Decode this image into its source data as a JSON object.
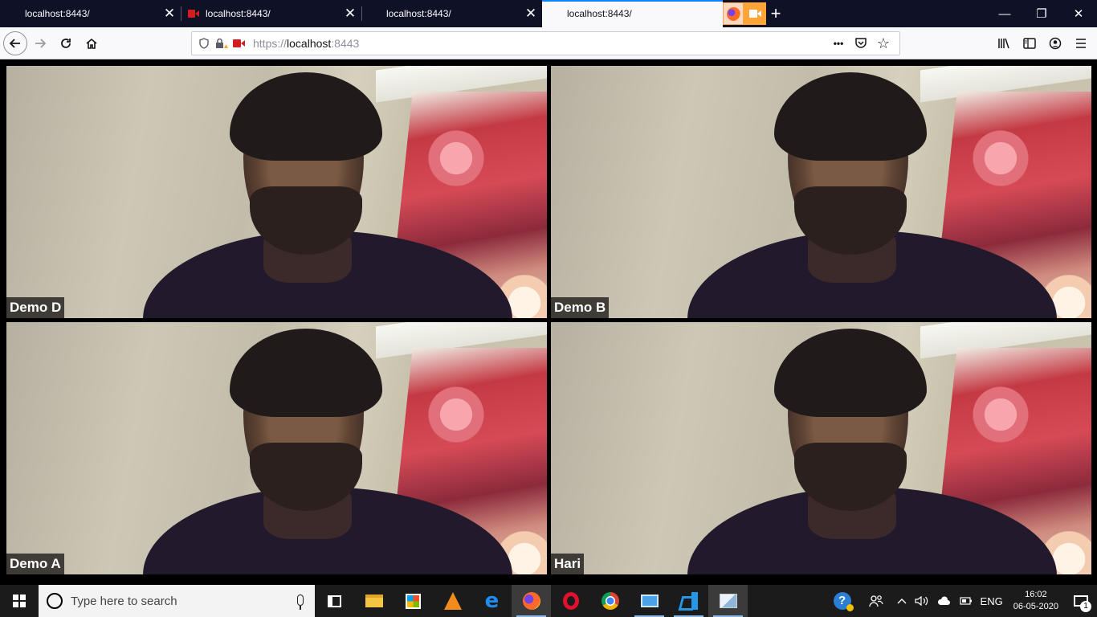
{
  "browser": {
    "tabs": [
      {
        "title": "localhost:8443/",
        "has_camera": false,
        "active": false
      },
      {
        "title": "localhost:8443/",
        "has_camera": true,
        "active": false
      },
      {
        "title": "localhost:8443/",
        "has_camera": false,
        "active": false
      },
      {
        "title": "localhost:8443/",
        "has_camera": false,
        "active": true
      }
    ],
    "new_tab_label": "+",
    "window_controls": {
      "minimize": "—",
      "restore": "❐",
      "close": "✕"
    },
    "url": {
      "scheme": "https://",
      "host": "localhost",
      "port": ":8443"
    },
    "url_actions": {
      "more": "•••",
      "pocket": "pocket-icon",
      "bookmark": "☆"
    }
  },
  "video_tiles": [
    {
      "name": "Demo D"
    },
    {
      "name": "Demo B"
    },
    {
      "name": "Demo A"
    },
    {
      "name": "Hari"
    }
  ],
  "taskbar": {
    "search_placeholder": "Type here to search",
    "apps": [
      "task-view",
      "file-explorer",
      "microsoft-store",
      "vlc",
      "edge",
      "firefox",
      "opera",
      "chrome",
      "remote-desktop",
      "vscode",
      "paint"
    ],
    "tray": {
      "language": "ENG",
      "time": "16:02",
      "date": "06-05-2020",
      "notification_count": "1"
    }
  },
  "colors": {
    "tabstrip_bg": "#0f1126",
    "active_tab_accent": "#0a84ff",
    "camera_indicator": "#d21e1e",
    "sharing_badge": "#ffa436",
    "taskbar_bg": "#1b1b1b"
  }
}
